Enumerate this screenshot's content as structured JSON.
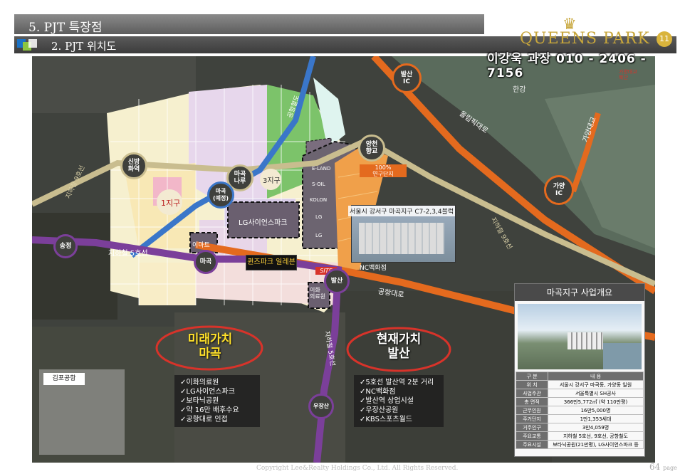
{
  "header": {
    "section_title": "5. PJT 특장점",
    "sub_title": "2. PJT 위치도",
    "logo_text": "QUEENS PARK",
    "logo_number": "11",
    "contact": "이강욱 과장 010 - 2406 - 7156"
  },
  "map_labels": {
    "balsan_ic": "발산\nIC",
    "gayang_ic": "가양\nIC",
    "hangang": "한강",
    "olympic": "올림픽대로",
    "gayang_bridge": "가양대교",
    "gonghang_road": "공항대로",
    "subway5": "지하철 5호선",
    "subway9_left": "지하철 9호선",
    "subway9_right": "지하철 9호선",
    "subway5_vertical": "지하철 5호선",
    "gonghang_railway": "공항철도",
    "district1": "1지구",
    "district3": "3지구",
    "lg_science": "LG사이언스파크",
    "emart": "이마트",
    "nc": "NC백화점",
    "site": "SITE",
    "ewha": "이화\n의료원",
    "gimpo": "김포공항",
    "lg_side1": "E-LAND",
    "lg_side2": "S-OIL",
    "lg_side3": "KOLON",
    "lg_side4": "LG",
    "lg_side5": "LG",
    "orange_tag": "100%\n연구단지",
    "caption": "서울시 강서구 마곡지구 C7-2,3,4블럭",
    "queens_label": "퀸즈파크 일레븐",
    "gayang_ghost": "가양대교\n북단"
  },
  "stations": {
    "songjeong": "송정",
    "magok": "마곡",
    "balsan": "발산",
    "ujangsan": "우장산",
    "sinbang": "신방\n화역",
    "magoknaru": "마곡\n나루",
    "magok_planned": "마곡\n(예정)",
    "yangcheon": "양천\n향교"
  },
  "future": {
    "title": "미래가치\n마곡",
    "items": [
      "✓이화의료원",
      "✓LG사이언스파크",
      "✓보타닉공원",
      "✓약 16만 배후수요",
      "✓공항대로 인접"
    ]
  },
  "present": {
    "title": "현재가치\n발산",
    "items": [
      "✓5호선 발산역 2분 거리",
      "✓NC백화점",
      "✓발산역 상업시설",
      "✓우장산공원",
      "✓KBS스포츠월드"
    ]
  },
  "panel": {
    "title": "마곡지구 사업개요",
    "rows": [
      [
        "구 분",
        "내 용"
      ],
      [
        "위 치",
        "서울시 강서구 마곡동, 가양동 일원"
      ],
      [
        "사업주관",
        "서울특별시 SH공사"
      ],
      [
        "총 면적",
        "366만5,772㎡ (약 110만평)"
      ],
      [
        "근무인원",
        "16만5,000명"
      ],
      [
        "주거단지",
        "1만1,353세대"
      ],
      [
        "거주인구",
        "3만4,059명"
      ],
      [
        "주요교통",
        "지하철 5호선, 9호선, 공항철도"
      ],
      [
        "주요시설",
        "보타닉공원(21만평), LG사이언스파크 등"
      ]
    ]
  },
  "footer": {
    "copyright": "Copyright Lee&Realty Holdings Co., Ltd. All Rights Reserved.",
    "page": "64",
    "page_suffix": "page"
  },
  "colors": {
    "gold": "#c7a63b",
    "orange_road": "#e46a1e",
    "purple_line": "#7b3f9a",
    "beige_line": "#c9bd8f",
    "blue_line": "#3a76c9"
  }
}
